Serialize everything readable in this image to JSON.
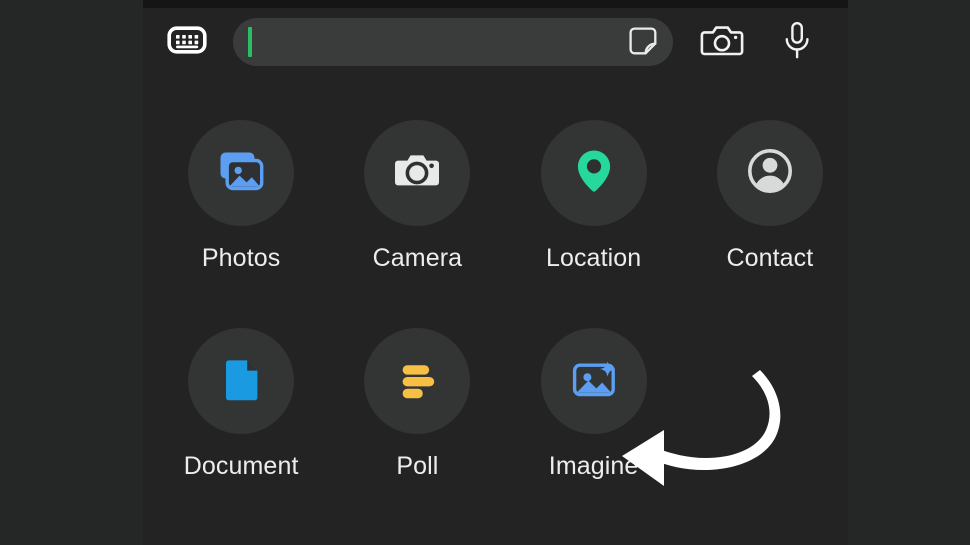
{
  "app": {
    "screen_name": "chat-attachment-sheet",
    "panel_bg": "#232323",
    "letterbox_bg": "#252726",
    "bubble_bg": "#333434",
    "label_color": "#eceeed"
  },
  "composer": {
    "keyboard_button": {
      "icon": "keyboard-icon",
      "label": "Keyboard"
    },
    "text_input": {
      "value": "",
      "placeholder": "",
      "caret_color": "#2bbd63",
      "field_color": "#3a3c3b"
    },
    "sticker_button": {
      "icon": "sticker-icon",
      "label": "Sticker"
    },
    "camera_button": {
      "icon": "camera-icon",
      "label": "Camera"
    },
    "mic_button": {
      "icon": "microphone-icon",
      "label": "Voice message"
    }
  },
  "attachments": {
    "rows": [
      [
        {
          "id": "photos",
          "label": "Photos",
          "icon": "photos-icon",
          "color": "#5c9ef2"
        },
        {
          "id": "camera",
          "label": "Camera",
          "icon": "camera-icon",
          "color": "#e8eaea"
        },
        {
          "id": "location",
          "label": "Location",
          "icon": "location-pin-icon",
          "color": "#27d89c"
        },
        {
          "id": "contact",
          "label": "Contact",
          "icon": "contact-icon",
          "color": "#d8dada"
        }
      ],
      [
        {
          "id": "document",
          "label": "Document",
          "icon": "document-icon",
          "color": "#1a9ae0"
        },
        {
          "id": "poll",
          "label": "Poll",
          "icon": "poll-icon",
          "color": "#f7bf44"
        },
        {
          "id": "imagine",
          "label": "Imagine",
          "icon": "imagine-icon",
          "color": "#5c9ef2"
        },
        {
          "id": "spacer",
          "label": "",
          "icon": "",
          "color": ""
        }
      ]
    ]
  },
  "annotation": {
    "arrow": {
      "name": "pointer-arrow",
      "color": "#ffffff",
      "points_to": "imagine",
      "direction": "left"
    }
  }
}
